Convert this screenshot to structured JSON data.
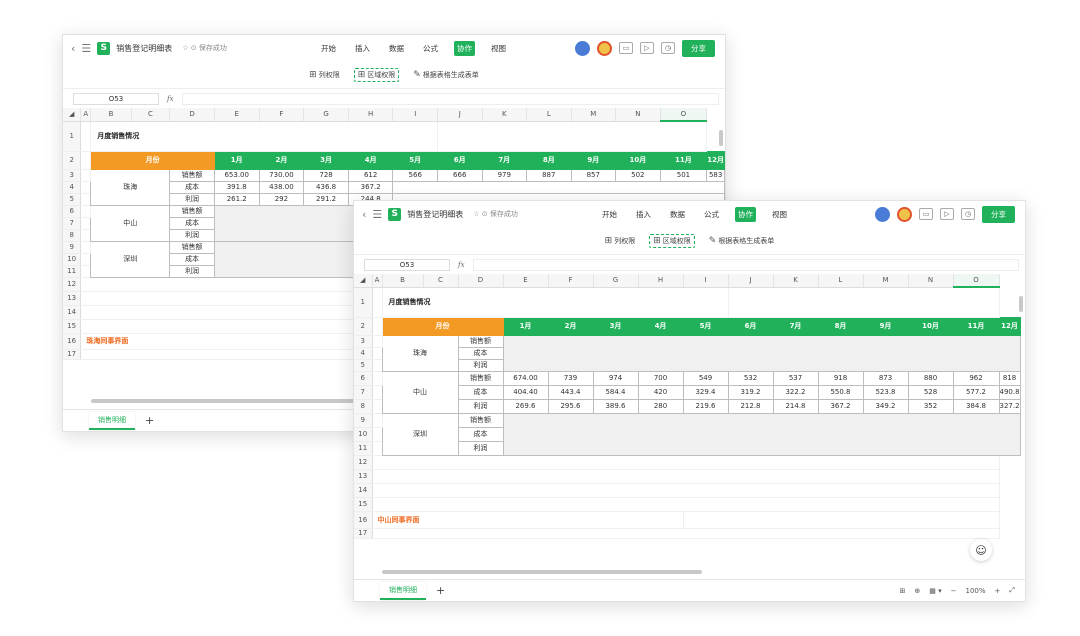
{
  "app": {
    "doc_title": "销售登记明细表",
    "saved_status": "☆ ⊙ 保存成功",
    "menu": [
      "开始",
      "插入",
      "数据",
      "公式",
      "协作",
      "视图"
    ],
    "active_menu": "协作",
    "share_label": "分享"
  },
  "toolbar": {
    "col_perm": "列权限",
    "area_perm": "区域权限",
    "gen_form": "根据表格生成表单"
  },
  "formula": {
    "cell_ref": "O53",
    "fx": "fx"
  },
  "columns": [
    "A",
    "B",
    "C",
    "D",
    "E",
    "F",
    "G",
    "H",
    "I",
    "J",
    "K",
    "L",
    "M",
    "N",
    "O"
  ],
  "rows": [
    "1",
    "2",
    "3",
    "4",
    "5",
    "6",
    "7",
    "8",
    "9",
    "10",
    "11",
    "12",
    "13",
    "14",
    "15",
    "16",
    "17"
  ],
  "sheet": {
    "title": "月度销售情况",
    "month_header": "月份",
    "months": [
      "1月",
      "2月",
      "3月",
      "4月",
      "5月",
      "6月",
      "7月",
      "8月",
      "9月",
      "10月",
      "11月",
      "12月"
    ],
    "metrics": [
      "销售额",
      "成本",
      "利润"
    ],
    "cities": [
      "珠海",
      "中山",
      "深圳"
    ],
    "zhuhai": {
      "sales": [
        "653.00",
        "730.00",
        "728",
        "612",
        "566",
        "666",
        "979",
        "887",
        "857",
        "502",
        "501",
        "583"
      ],
      "cost": [
        "391.8",
        "438.00",
        "436.8",
        "367.2"
      ],
      "profit": [
        "261.2",
        "292",
        "291.2",
        "244.8"
      ]
    },
    "zhongshan": {
      "sales": [
        "674.00",
        "739",
        "974",
        "700",
        "549",
        "532",
        "537",
        "918",
        "873",
        "880",
        "962",
        "818"
      ],
      "cost": [
        "404.40",
        "443.4",
        "584.4",
        "420",
        "329.4",
        "319.2",
        "322.2",
        "550.8",
        "523.8",
        "528",
        "577.2",
        "490.8"
      ],
      "profit": [
        "269.6",
        "295.6",
        "389.6",
        "280",
        "219.6",
        "212.8",
        "214.8",
        "367.2",
        "349.2",
        "352",
        "384.8",
        "327.2"
      ]
    }
  },
  "captions": {
    "w1": "珠海同事界面",
    "w2": "中山同事界面"
  },
  "sheet_tab": "销售明细",
  "zoom": "100%"
}
